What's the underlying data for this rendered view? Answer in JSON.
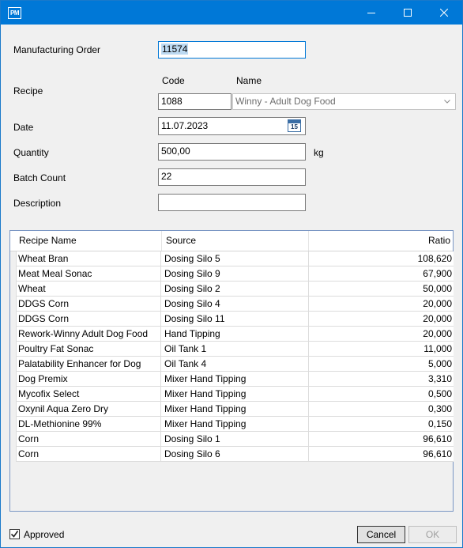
{
  "window": {
    "app_icon_text": "PM",
    "minimize_label": "",
    "maximize_label": "",
    "close_label": ""
  },
  "form": {
    "manufacturing_order_label": "Manufacturing Order",
    "manufacturing_order_value": "11574",
    "recipe_label": "Recipe",
    "code_header": "Code",
    "name_header": "Name",
    "recipe_code_value": "1088",
    "recipe_name_value": "Winny - Adult Dog Food",
    "date_label": "Date",
    "date_value": "11.07.2023",
    "calendar_day": "15",
    "quantity_label": "Quantity",
    "quantity_value": "500,00",
    "quantity_unit": "kg",
    "batch_count_label": "Batch Count",
    "batch_count_value": "22",
    "description_label": "Description",
    "description_value": ""
  },
  "grid": {
    "columns": [
      "Recipe Name",
      "Source",
      "Ratio"
    ],
    "rows": [
      [
        "Wheat Bran",
        "Dosing Silo 5",
        "108,620"
      ],
      [
        "Meat Meal Sonac",
        "Dosing Silo 9",
        "67,900"
      ],
      [
        "Wheat",
        "Dosing Silo 2",
        "50,000"
      ],
      [
        "DDGS Corn",
        "Dosing Silo 4",
        "20,000"
      ],
      [
        "DDGS Corn",
        "Dosing Silo 11",
        "20,000"
      ],
      [
        "Rework-Winny Adult Dog Food",
        "Hand Tipping",
        "20,000"
      ],
      [
        "Poultry Fat Sonac",
        "Oil Tank 1",
        "11,000"
      ],
      [
        "Palatability Enhancer for Dog",
        "Oil Tank 4",
        "5,000"
      ],
      [
        "Dog Premix",
        "Mixer Hand Tipping",
        "3,310"
      ],
      [
        "Mycofix Select",
        "Mixer Hand Tipping",
        "0,500"
      ],
      [
        "Oxynil Aqua Zero Dry",
        "Mixer Hand Tipping",
        "0,300"
      ],
      [
        "DL-Methionine 99%",
        "Mixer Hand Tipping",
        "0,150"
      ],
      [
        "Corn",
        "Dosing Silo 1",
        "96,610"
      ],
      [
        "Corn",
        "Dosing Silo 6",
        "96,610"
      ]
    ]
  },
  "footer": {
    "approved_label": "Approved",
    "approved_checked": true,
    "cancel_label": "Cancel",
    "ok_label": "OK"
  },
  "colors": {
    "titlebar": "#0078d7",
    "selection": "#bcd9f1",
    "grid_border": "#7a96c4"
  }
}
